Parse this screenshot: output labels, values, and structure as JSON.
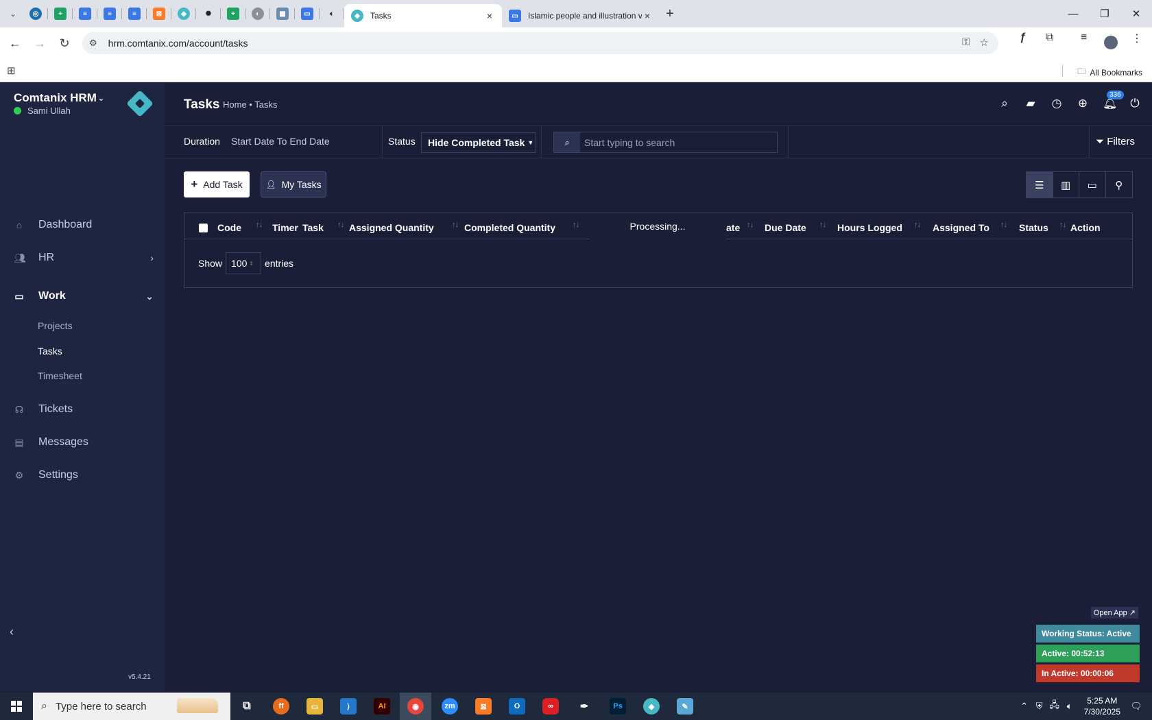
{
  "browser": {
    "tabs": [
      {
        "title": "Tasks",
        "active": true
      },
      {
        "title": "Islamic people and illustration v",
        "active": false
      }
    ],
    "pinned_icons": [
      "vpn-icon",
      "sheets-icon",
      "docs-icon",
      "docs-icon",
      "docs-icon",
      "xampp-icon",
      "comtanix-icon",
      "openai-icon",
      "sheets-icon",
      "globe-icon",
      "qr-icon",
      "forms-icon",
      "audio-icon"
    ],
    "url": "hrm.comtanix.com/account/tasks",
    "bookmarks_label": "All Bookmarks"
  },
  "sidebar": {
    "brand": "Comtanix HRM",
    "user": "Sami Ullah",
    "items": [
      {
        "label": "Dashboard",
        "icon": "home-icon"
      },
      {
        "label": "HR",
        "icon": "users-icon"
      },
      {
        "label": "Work",
        "icon": "briefcase-icon"
      },
      {
        "label": "Tickets",
        "icon": "headset-icon"
      },
      {
        "label": "Messages",
        "icon": "message-icon"
      },
      {
        "label": "Settings",
        "icon": "gear-icon"
      }
    ],
    "work_subitems": [
      "Projects",
      "Tasks",
      "Timesheet"
    ],
    "version": "v5.4.21"
  },
  "header": {
    "title": "Tasks",
    "breadcrumb": "Home • Tasks",
    "notification_count": "336"
  },
  "filters": {
    "duration_label": "Duration",
    "duration_value": "Start Date To End Date",
    "status_label": "Status",
    "status_value": "Hide Completed Task",
    "search_placeholder": "Start typing to search",
    "filters_label": "Filters"
  },
  "actions": {
    "add_task": "Add Task",
    "my_tasks": "My Tasks"
  },
  "table": {
    "columns": [
      "Code",
      "Timer",
      "Task",
      "Assigned Quantity",
      "Completed Quantity",
      "ate",
      "Due Date",
      "Hours Logged",
      "Assigned To",
      "Status",
      "Action"
    ],
    "processing": "Processing...",
    "show_label": "Show",
    "entries_value": "100",
    "entries_label": "entries"
  },
  "widget": {
    "open_app": "Open App ↗",
    "working_status": "Working Status: Active",
    "active": "Active: 00:52:13",
    "inactive": "In Active: 00:00:06",
    "colors": {
      "working": "#3f8a9c",
      "active": "#2fa05a",
      "inactive": "#c0392b"
    }
  },
  "taskbar": {
    "search_placeholder": "Type here to search",
    "time": "5:25 AM",
    "date": "7/30/2025"
  },
  "colors": {
    "app_bg": "#1a1e36",
    "sidebar_bg": "#1e2540",
    "accent": "#46b8c5",
    "badge": "#2d7fe3"
  }
}
